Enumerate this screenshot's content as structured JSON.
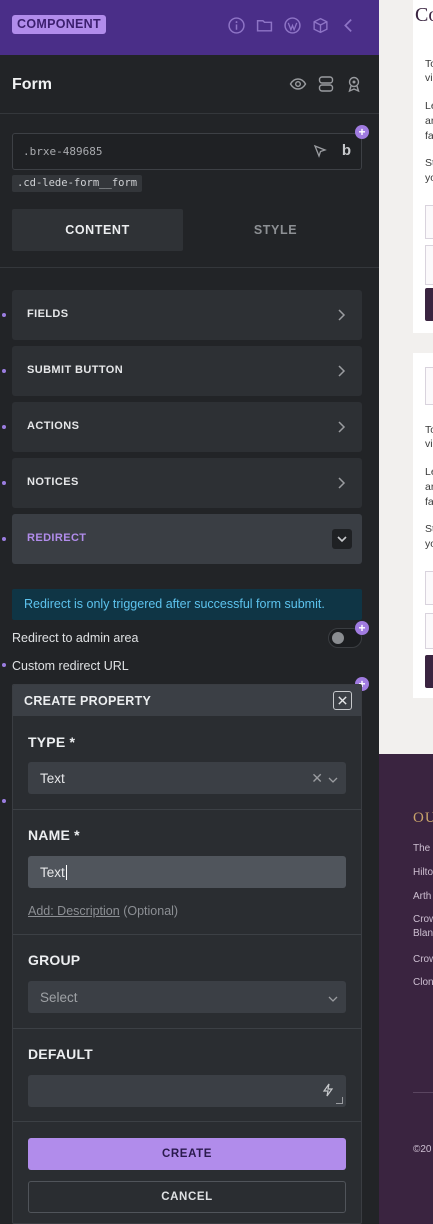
{
  "topbar": {
    "badge": "COMPONENT",
    "icons": [
      "info-icon",
      "folder-icon",
      "wordpress-icon",
      "box-icon",
      "chevron-left-icon"
    ]
  },
  "header": {
    "title": "Form",
    "icons": [
      "eye-icon",
      "layers-icon",
      "badge-icon"
    ]
  },
  "selector": {
    "id": ".brxe-489685",
    "class_chip": ".cd-lede-form__form"
  },
  "tabs": [
    {
      "label": "CONTENT",
      "active": true
    },
    {
      "label": "STYLE",
      "active": false
    }
  ],
  "accordion": [
    {
      "label": "FIELDS"
    },
    {
      "label": "SUBMIT BUTTON"
    },
    {
      "label": "ACTIONS"
    },
    {
      "label": "NOTICES"
    },
    {
      "label": "REDIRECT",
      "open": true
    }
  ],
  "redirect": {
    "notice": "Redirect is only triggered after successful form submit.",
    "admin_label": "Redirect to admin area",
    "custom_label": "Custom redirect URL",
    "admin_toggle_on": false
  },
  "modal": {
    "title": "CREATE PROPERTY",
    "type_label": "TYPE *",
    "type_value": "Text",
    "name_label": "NAME *",
    "name_value": "Text",
    "add_desc_link": "Add: Description",
    "add_desc_optional": "(Optional)",
    "group_label": "GROUP",
    "group_placeholder": "Select",
    "default_label": "DEFAULT",
    "default_value": "",
    "create_label": "CREATE",
    "cancel_label": "CANCEL"
  },
  "preview": {
    "logo": "Co",
    "card1": [
      "To",
      "vi",
      "Le",
      "ar",
      "fa",
      "St",
      "yo"
    ],
    "card2": [
      "To",
      "vi",
      "Le",
      "ar",
      "fa",
      "St",
      "yo"
    ],
    "footer_head": "OU",
    "footer_links": [
      "The l",
      "Hilto",
      "Arth",
      "Crow",
      "Blan",
      "Crow",
      "Clon"
    ],
    "copyright": "©20"
  },
  "colors": {
    "accent": "#b18ceb",
    "topbar": "#4a2e88",
    "notice_bg": "#0f3545",
    "notice_text": "#5dc3ee",
    "footer_bg": "#3a2440"
  }
}
